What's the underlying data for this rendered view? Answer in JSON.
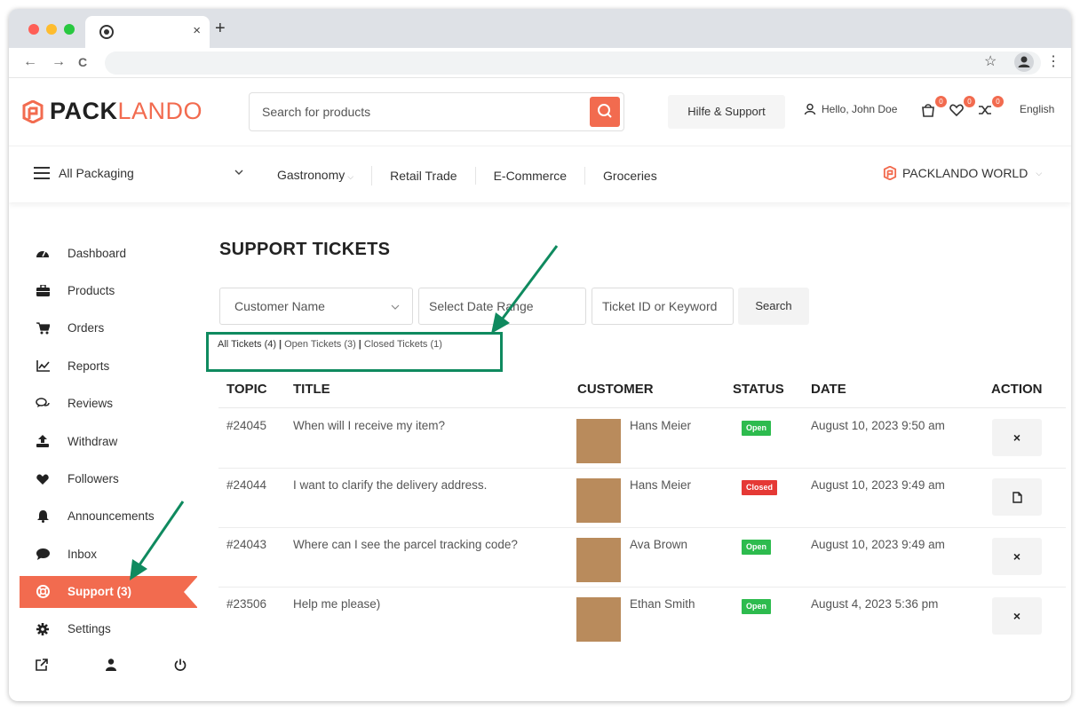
{
  "browser": {
    "tab_close": "×",
    "new_tab": "+",
    "back": "←",
    "forward": "→",
    "reload": "C",
    "star": "☆",
    "menu": "⋮",
    "traffic_colors": [
      "#ff5f57",
      "#febc2e",
      "#28c840"
    ]
  },
  "header": {
    "logo_pack": "PACK",
    "logo_lando": "LANDO",
    "search_placeholder": "Search for products",
    "help_label": "Hilfe & Support",
    "hello_label": "Hello, John Doe",
    "cart_count": "0",
    "wishlist_count": "0",
    "compare_count": "0",
    "language": "English"
  },
  "catnav": {
    "all_label": "All Packaging",
    "chevron": "⌄",
    "items": [
      "Gastronomy",
      "Retail Trade",
      "E-Commerce",
      "Groceries"
    ],
    "world_label": "PACKLANDO WORLD"
  },
  "sidebar": {
    "items": [
      {
        "label": "Dashboard",
        "icon": "dashboard-icon"
      },
      {
        "label": "Products",
        "icon": "briefcase-icon"
      },
      {
        "label": "Orders",
        "icon": "cart-icon"
      },
      {
        "label": "Reports",
        "icon": "chart-icon"
      },
      {
        "label": "Reviews",
        "icon": "comments-icon"
      },
      {
        "label": "Withdraw",
        "icon": "upload-icon"
      },
      {
        "label": "Followers",
        "icon": "heart-icon"
      },
      {
        "label": "Announcements",
        "icon": "bell-icon"
      },
      {
        "label": "Inbox",
        "icon": "chat-icon"
      },
      {
        "label": "Support (3)",
        "icon": "lifebuoy-icon"
      },
      {
        "label": "Settings",
        "icon": "gear-icon"
      }
    ]
  },
  "main": {
    "title": "SUPPORT TICKETS",
    "filters": {
      "customer": "Customer Name",
      "date_placeholder": "Select Date Range",
      "keyword_placeholder": "Ticket ID or Keyword",
      "search_label": "Search"
    },
    "ticket_tabs": {
      "all": "All Tickets (4)",
      "open": "Open Tickets (3)",
      "closed": "Closed Tickets (1)",
      "separator": "|"
    },
    "columns": [
      "TOPIC",
      "TITLE",
      "CUSTOMER",
      "STATUS",
      "DATE",
      "ACTION"
    ],
    "rows": [
      {
        "topic": "#24045",
        "title": "When will I receive my item?",
        "customer": "Hans Meier",
        "status": "Open",
        "date": "August 10, 2023 9:50 am",
        "action": "×",
        "action_icon": "close-icon"
      },
      {
        "topic": "#24044",
        "title": "I want to clarify the delivery address.",
        "customer": "Hans Meier",
        "status": "Closed",
        "date": "August 10, 2023 9:49 am",
        "action": "",
        "action_icon": "file-icon"
      },
      {
        "topic": "#24043",
        "title": "Where can I see the parcel tracking code?",
        "customer": "Ava Brown",
        "status": "Open",
        "date": "August 10, 2023 9:49 am",
        "action": "×",
        "action_icon": "close-icon"
      },
      {
        "topic": "#23506",
        "title": "Help me please)",
        "customer": "Ethan Smith",
        "status": "Open",
        "date": "August 4, 2023 5:36 pm",
        "action": "×",
        "action_icon": "close-icon"
      }
    ]
  },
  "colors": {
    "brand": "#f26b4f",
    "open": "#2dbb4e",
    "closed": "#e53935",
    "annotation": "#0f8a5f",
    "thumb": "#b98b5c"
  }
}
